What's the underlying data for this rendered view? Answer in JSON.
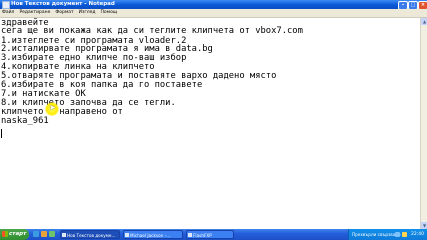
{
  "window": {
    "title": "Нов Текстов документ - Notepad",
    "menu": [
      "Файл",
      "Редактиране",
      "Формат",
      "Изглед",
      "Помощ"
    ]
  },
  "document": {
    "lines": [
      "здравейте",
      "сега ще ви покажа как да си теглите клипчета от vbox7.com",
      "1.изтеглете си програмата vloader.2",
      "2.исталирвате програмата я има в data.bg",
      "3.избирате едно клипче по-ваш избор",
      "4.копирвате линка на клипчето",
      "5.отваряте програмата и поставяте вархо дадено място",
      "6.избирате в коя папка да го поставете",
      "7.и натискате ОК",
      "8.и клипчето започва да се тегли.",
      "клипчето е направено от",
      "naska_961"
    ]
  },
  "taskbar": {
    "start_label": "старт",
    "tasks": [
      "Нов Текстов докуме...",
      "Michael Jackson -...",
      "FlashFXP"
    ],
    "tray_link": "Прехвърли свързване",
    "clock": "22:40"
  },
  "colors": {
    "titlebar": "#0a58d6",
    "taskbar": "#245edb",
    "start": "#2f8f2f",
    "cursor_highlight": "#ffea00"
  },
  "icons": [
    "notepad-icon",
    "minimize-icon",
    "maximize-icon",
    "close-icon",
    "windows-flag-icon",
    "mouse-pointer-icon"
  ]
}
